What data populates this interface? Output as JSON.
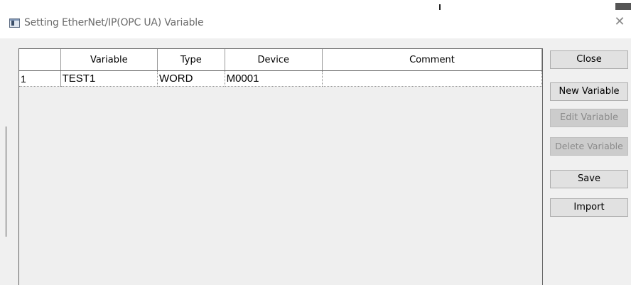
{
  "window": {
    "title": "Setting EtherNet/IP(OPC UA) Variable"
  },
  "grid": {
    "columns": [
      {
        "label": ""
      },
      {
        "label": "Variable"
      },
      {
        "label": "Type"
      },
      {
        "label": "Device"
      },
      {
        "label": "Comment"
      }
    ],
    "rows": [
      {
        "num": "1",
        "variable": "TEST1",
        "type": "WORD",
        "device": "M0001",
        "comment": ""
      }
    ]
  },
  "buttons": {
    "close": "Close",
    "new_variable": "New Variable",
    "edit_variable": "Edit Variable",
    "delete_variable": "Delete Variable",
    "save": "Save",
    "import": "Import"
  },
  "icons": {
    "title_icon": "app-window-icon",
    "close_icon": "close-icon"
  }
}
